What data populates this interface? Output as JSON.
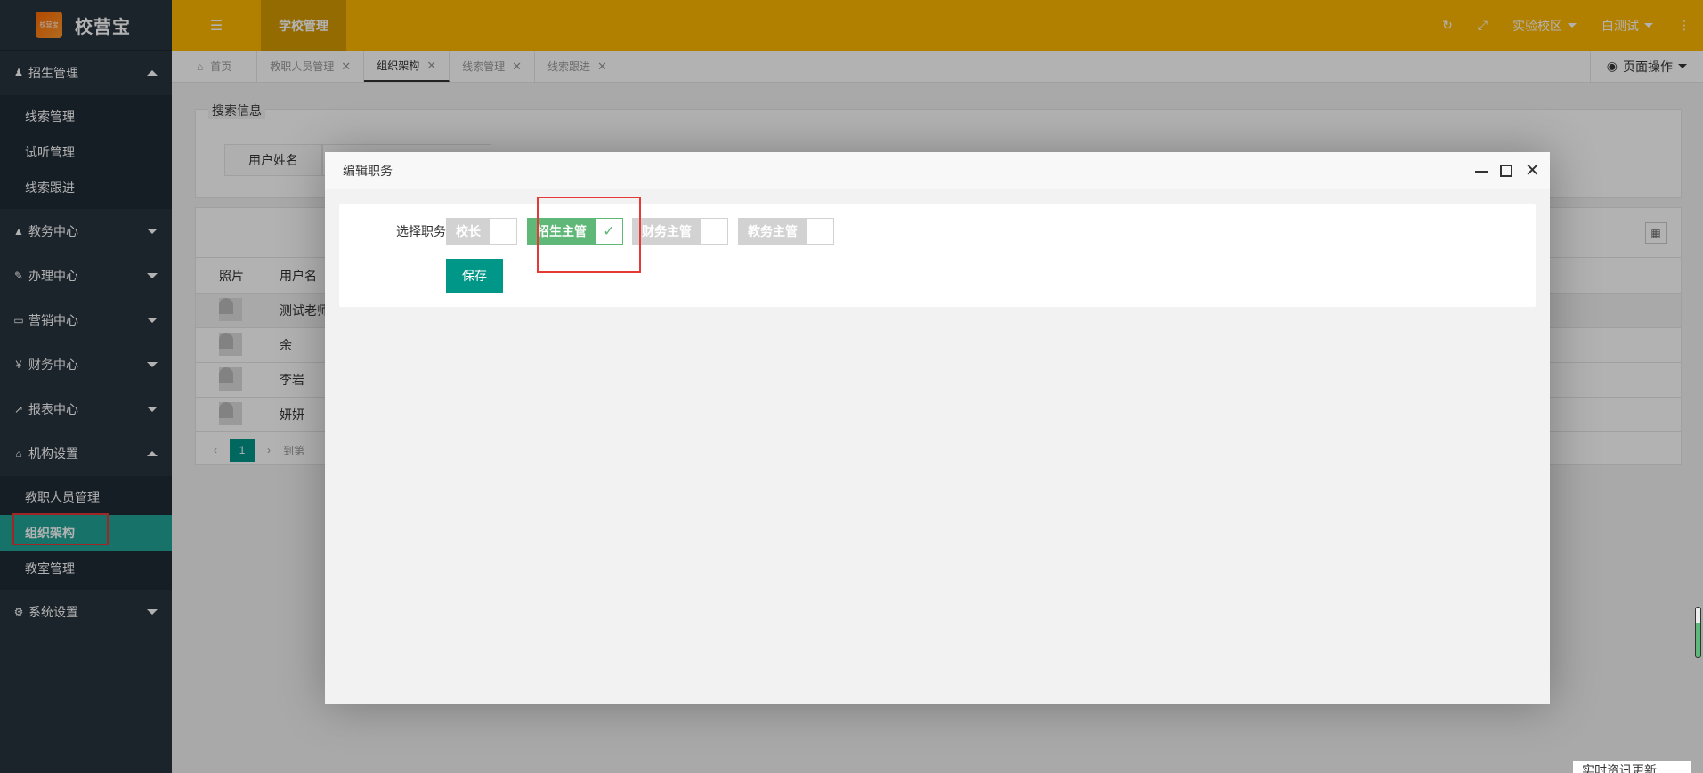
{
  "app": {
    "logo_mark": "校营宝",
    "name": "校营宝"
  },
  "header": {
    "active_tab": "学校管理",
    "campus": "实验校区",
    "user": "白测试"
  },
  "sidebar": {
    "groups": [
      {
        "label": "招生管理",
        "icon": "user-icon",
        "expanded": true,
        "items": [
          "线索管理",
          "试听管理",
          "线索跟进"
        ]
      },
      {
        "label": "教务中心",
        "icon": "graduation-cap-icon",
        "expanded": false
      },
      {
        "label": "办理中心",
        "icon": "edit-icon",
        "expanded": false
      },
      {
        "label": "营销中心",
        "icon": "laptop-icon",
        "expanded": false
      },
      {
        "label": "财务中心",
        "icon": "yen-icon",
        "expanded": false
      },
      {
        "label": "报表中心",
        "icon": "chart-icon",
        "expanded": false
      },
      {
        "label": "机构设置",
        "icon": "bank-icon",
        "expanded": true,
        "items": [
          "教职人员管理",
          "组织架构",
          "教室管理"
        ],
        "active_item": "组织架构"
      },
      {
        "label": "系统设置",
        "icon": "gears-icon",
        "expanded": false
      }
    ]
  },
  "tabs": {
    "home": "首页",
    "items": [
      "教职人员管理",
      "组织架构",
      "线索管理",
      "线索跟进"
    ],
    "active": "组织架构",
    "page_ops": "页面操作"
  },
  "search": {
    "legend": "搜索信息",
    "user_name_label": "用户姓名"
  },
  "table": {
    "headers": [
      "照片",
      "用户名"
    ],
    "rows": [
      "测试老师",
      "余",
      "李岩",
      "妍妍"
    ],
    "pager": {
      "current": "1",
      "goto": "到第"
    }
  },
  "dialog": {
    "title": "编辑职务",
    "row_label": "选择职务",
    "roles": [
      {
        "label": "校长",
        "checked": false
      },
      {
        "label": "招生主管",
        "checked": true
      },
      {
        "label": "财务主管",
        "checked": false
      },
      {
        "label": "教务主管",
        "checked": false
      }
    ],
    "save": "保存"
  },
  "news": "实时资讯更新",
  "colors": {
    "header": "#ffb800",
    "sidebar": "#28333e",
    "accent": "#009688",
    "check_on": "#5fb878",
    "highlight": "#e53935"
  }
}
